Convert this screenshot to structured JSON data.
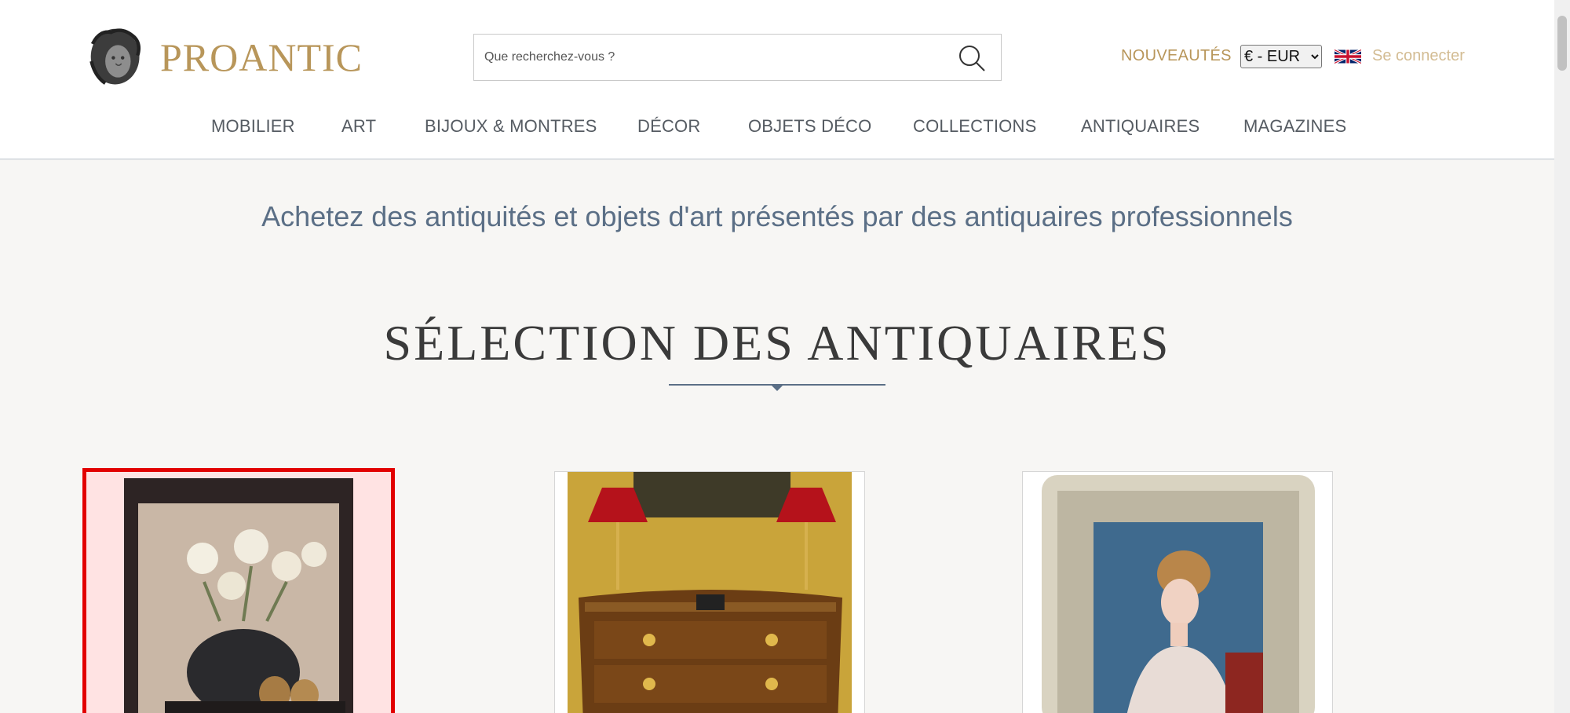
{
  "header": {
    "logo_text": "PROANTIC",
    "search_placeholder": "Que recherchez-vous ?",
    "nouveautes": "NOUVEAUTÉS",
    "currency": "€ - EUR",
    "currency_options": [
      "€ - EUR"
    ],
    "login": "Se connecter"
  },
  "nav": {
    "items": [
      {
        "label": "MOBILIER"
      },
      {
        "label": "ART"
      },
      {
        "label": "BIJOUX & MONTRES"
      },
      {
        "label": "DÉCOR"
      },
      {
        "label": "OBJETS DÉCO"
      },
      {
        "label": "COLLECTIONS"
      },
      {
        "label": "ANTIQUAIRES"
      },
      {
        "label": "MAGAZINES"
      }
    ]
  },
  "main": {
    "tagline": "Achetez des antiquités et objets d'art présentés par des antiquaires professionnels",
    "section_title": "SÉLECTION DES ANTIQUAIRES"
  },
  "colors": {
    "brand_gold": "#b8965a",
    "tagline_blue": "#5b6f86",
    "selection_red": "#e20000"
  },
  "icons": {
    "search": "search-icon",
    "flag": "uk-flag-icon",
    "logo": "medusa-head-logo"
  }
}
